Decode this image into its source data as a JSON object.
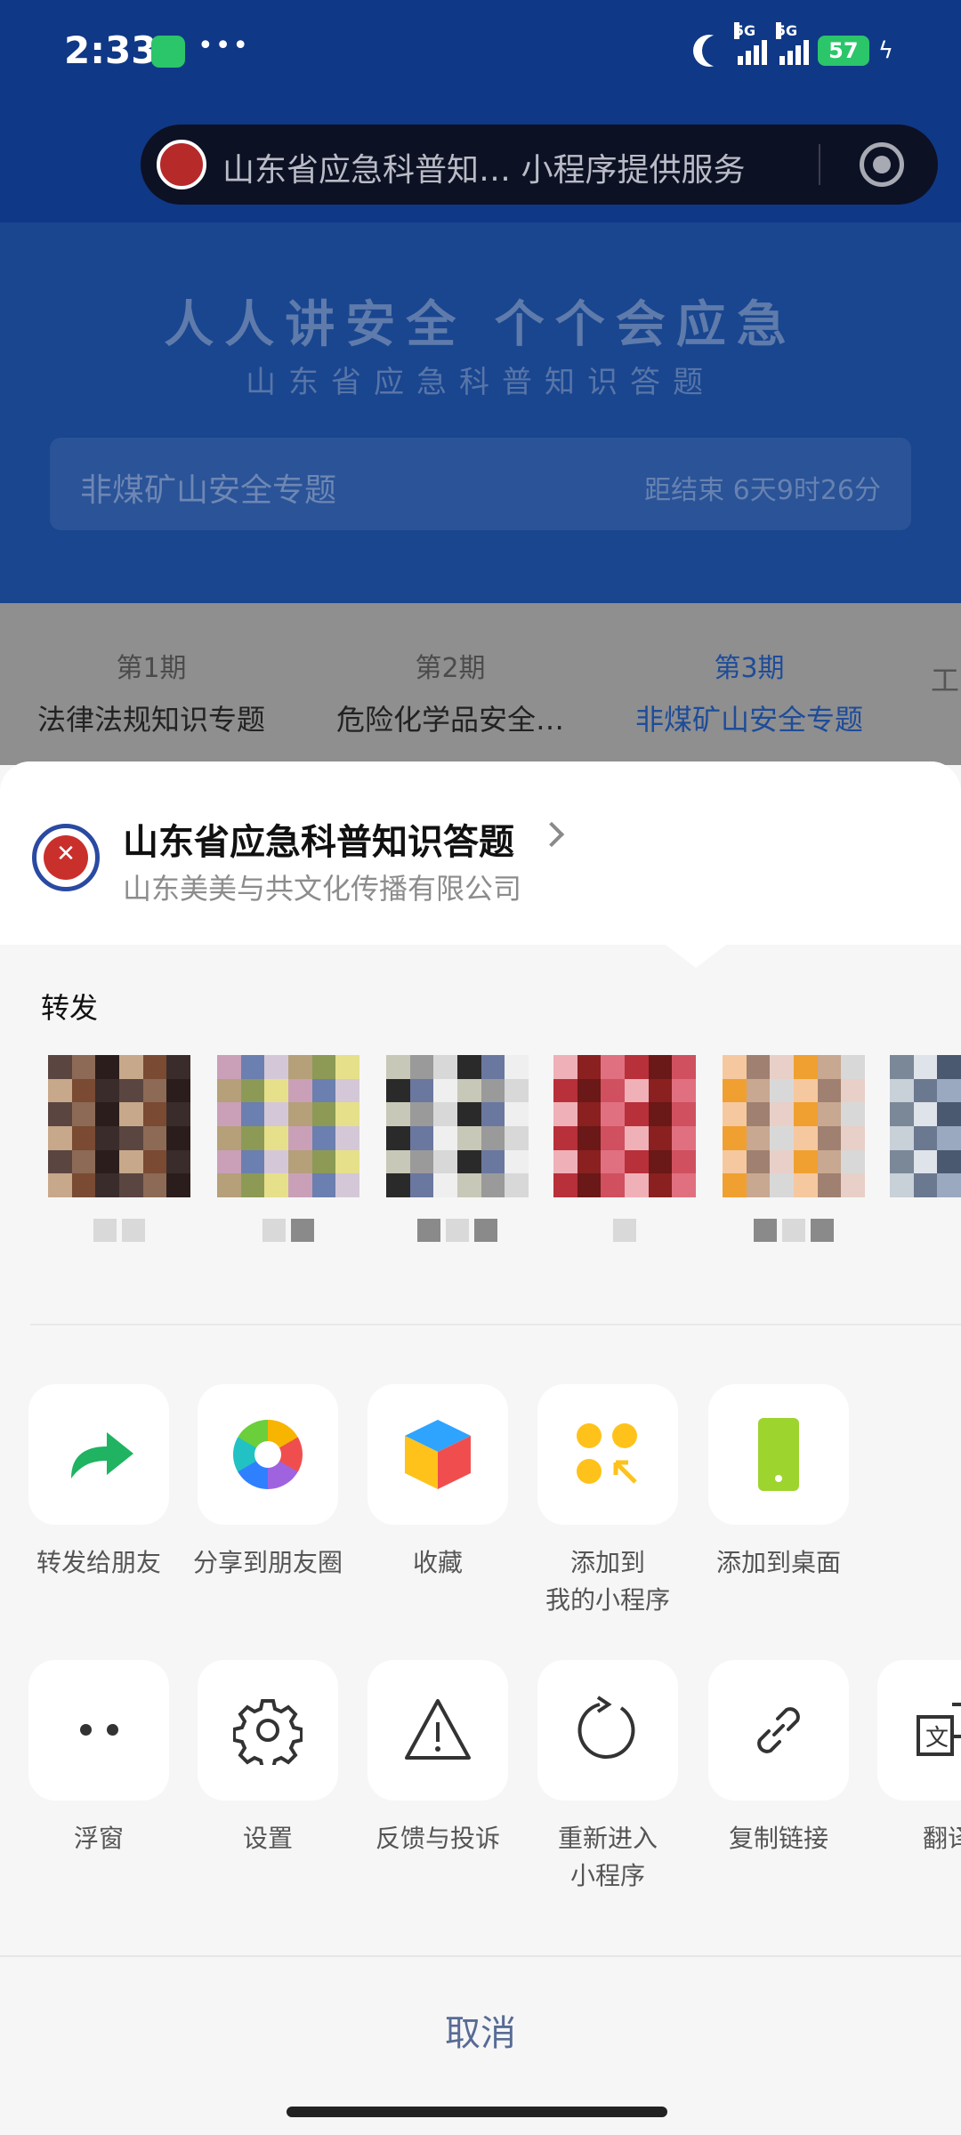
{
  "status_bar": {
    "time": "2:33",
    "signal1_label": "5G",
    "signal2_label": "5G",
    "battery": "57",
    "icons": [
      "wechat-icon",
      "more-dots-icon",
      "moon-icon",
      "signal-icon",
      "battery-icon",
      "charging-icon"
    ]
  },
  "capsule": {
    "text": "山东省应急科普知… 小程序提供服务"
  },
  "background_page": {
    "slogan": "人人讲安全  个个会应急",
    "subtitle": "山东省应急科普知识答题",
    "topic_title": "非煤矿山安全专题",
    "countdown": "距结束 6天9时26分",
    "issues": [
      {
        "num": "第1期",
        "name": "法律法规知识专题"
      },
      {
        "num": "第2期",
        "name": "危险化学品安全…"
      },
      {
        "num": "第3期",
        "name": "非煤矿山安全专题"
      },
      {
        "num": "",
        "name": "工"
      }
    ]
  },
  "sheet": {
    "app_name": "山东省应急科普知识答题",
    "company": "山东美美与共文化传播有限公司",
    "forward_label": "转发",
    "row1": [
      {
        "label": "转发给朋友",
        "icon": "forward-arrow-icon"
      },
      {
        "label": "分享到朋友圈",
        "icon": "moments-aperture-icon"
      },
      {
        "label": "收藏",
        "icon": "favorite-cube-icon"
      },
      {
        "label": "添加到\n我的小程序",
        "icon": "add-mini-program-icon"
      },
      {
        "label": "添加到桌面",
        "icon": "add-to-desktop-icon"
      }
    ],
    "row2": [
      {
        "label": "浮窗",
        "icon": "float-window-icon"
      },
      {
        "label": "设置",
        "icon": "gear-icon"
      },
      {
        "label": "反馈与投诉",
        "icon": "warning-icon"
      },
      {
        "label": "重新进入\n小程序",
        "icon": "reload-icon"
      },
      {
        "label": "复制链接",
        "icon": "link-icon"
      },
      {
        "label": "翻译",
        "icon": "translate-icon"
      }
    ],
    "cancel": "取消"
  },
  "colors": {
    "header_blue": "#0f3886",
    "active_issue": "#1e4c99",
    "cancel_text": "#576b95",
    "forward_green": "#1fb362"
  }
}
